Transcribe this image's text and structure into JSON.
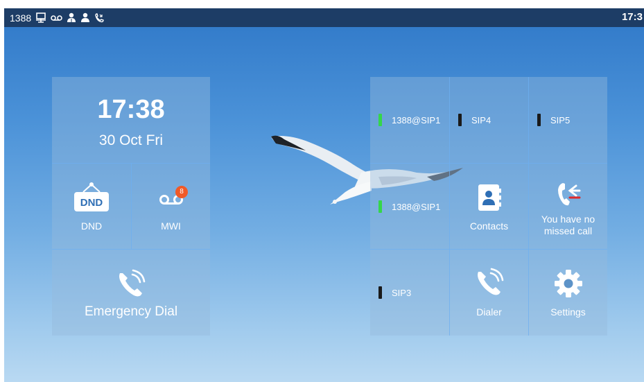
{
  "status_bar": {
    "extension": "1388",
    "time": "17:3",
    "icons": [
      "screen-share-icon",
      "voicemail-icon",
      "contact-group-icon",
      "contact-icon",
      "missed-call-icon"
    ]
  },
  "clock": {
    "time": "17:38",
    "date": "30 Oct Fri"
  },
  "left_tiles": {
    "dnd": {
      "label": "DND",
      "icon_text": "DND"
    },
    "mwi": {
      "label": "MWI",
      "badge": "8"
    },
    "emergency": {
      "label": "Emergency Dial"
    }
  },
  "lines": [
    {
      "label": "1388@SIP1",
      "status": "registered"
    },
    {
      "label": "SIP4",
      "status": "unregistered"
    },
    {
      "label": "SIP5",
      "status": "unregistered"
    },
    {
      "label": "1388@SIP1",
      "status": "registered"
    },
    {
      "label": "SIP3",
      "status": "unregistered"
    }
  ],
  "apps": {
    "contacts": {
      "label": "Contacts"
    },
    "missed": {
      "label_line1": "You have no",
      "label_line2": "missed call"
    },
    "dialer": {
      "label": "Dialer"
    },
    "settings": {
      "label": "Settings"
    }
  },
  "colors": {
    "status_bar_bg": "#1d3d66",
    "line_registered": "#35d64a",
    "line_unregistered": "#1a1a1a",
    "badge": "#f05a28",
    "missed_call_dash": "#e02a2a"
  }
}
